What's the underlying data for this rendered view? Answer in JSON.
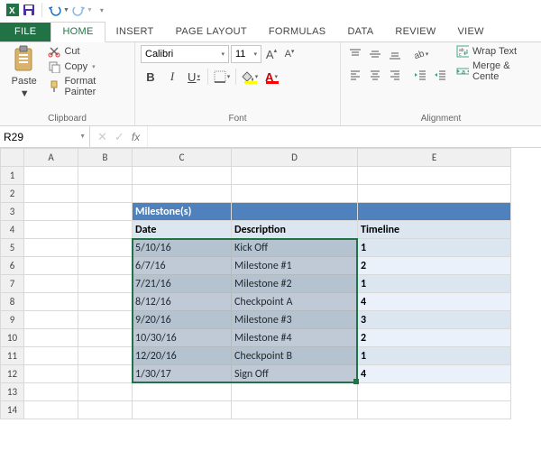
{
  "qat": {
    "save": "💾",
    "undo": "↶",
    "redo": "↷"
  },
  "tabs": {
    "file": "FILE",
    "list": [
      "HOME",
      "INSERT",
      "PAGE LAYOUT",
      "FORMULAS",
      "DATA",
      "REVIEW",
      "VIEW"
    ],
    "active_index": 0
  },
  "ribbon": {
    "clipboard": {
      "paste": "Paste",
      "cut": "Cut",
      "copy": "Copy",
      "format_painter": "Format Painter",
      "label": "Clipboard"
    },
    "font": {
      "name": "Calibri",
      "size": "11",
      "bold": "B",
      "italic": "I",
      "underline": "U",
      "grow": "A",
      "shrink": "A",
      "fill_color": "#ffff00",
      "font_color": "#ff0000",
      "label": "Font"
    },
    "alignment": {
      "wrap": "Wrap Text",
      "merge": "Merge & Cente",
      "label": "Alignment"
    }
  },
  "namebox": "R29",
  "formula": "",
  "columns": [
    "A",
    "B",
    "C",
    "D",
    "E"
  ],
  "row_count": 14,
  "table": {
    "header_title": "Milestone(s)",
    "col_headers": {
      "date": "Date",
      "desc": "Description",
      "timeline": "Timeline"
    },
    "rows": [
      {
        "date": "5/10/16",
        "desc": "Kick Off",
        "timeline": "1"
      },
      {
        "date": "6/7/16",
        "desc": "Milestone #1",
        "timeline": "2"
      },
      {
        "date": "7/21/16",
        "desc": "Milestone #2",
        "timeline": "1"
      },
      {
        "date": "8/12/16",
        "desc": "Checkpoint A",
        "timeline": "4"
      },
      {
        "date": "9/20/16",
        "desc": "Milestone #3",
        "timeline": "3"
      },
      {
        "date": "10/30/16",
        "desc": "Milestone #4",
        "timeline": "2"
      },
      {
        "date": "12/20/16",
        "desc": "Checkpoint B",
        "timeline": "1"
      },
      {
        "date": "1/30/17",
        "desc": "Sign Off",
        "timeline": "4"
      }
    ]
  },
  "colors": {
    "header_blue": "#4f81bd",
    "stripe_light": "#eaf1fa",
    "stripe_dark": "#dce6f1",
    "selection_green": "#217346"
  }
}
